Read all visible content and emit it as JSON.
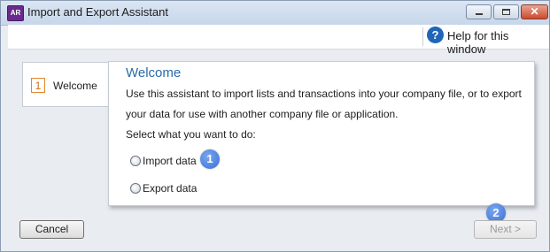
{
  "window": {
    "title": "Import and Export Assistant",
    "app_icon_text": "AR"
  },
  "helpbar": {
    "help_icon_glyph": "?",
    "help_label": "Help for this window"
  },
  "steps": [
    {
      "number": "1",
      "label": "Welcome"
    }
  ],
  "panel": {
    "title": "Welcome",
    "line1": "Use this assistant to import lists and transactions into your company file, or to export",
    "line2": "your data for use with another company file or application.",
    "prompt": "Select what you want to do:",
    "options": [
      {
        "label": "Import data",
        "selected": false
      },
      {
        "label": "Export data",
        "selected": false
      }
    ]
  },
  "annotations": {
    "badge1": "1",
    "badge2": "2"
  },
  "footer": {
    "cancel_label": "Cancel",
    "next_label": "Next >"
  },
  "colors": {
    "accent_title": "#2a6aa8",
    "step_number": "#e1882b",
    "help_icon": "#1f65b8",
    "badge": "#3a6fd6"
  }
}
